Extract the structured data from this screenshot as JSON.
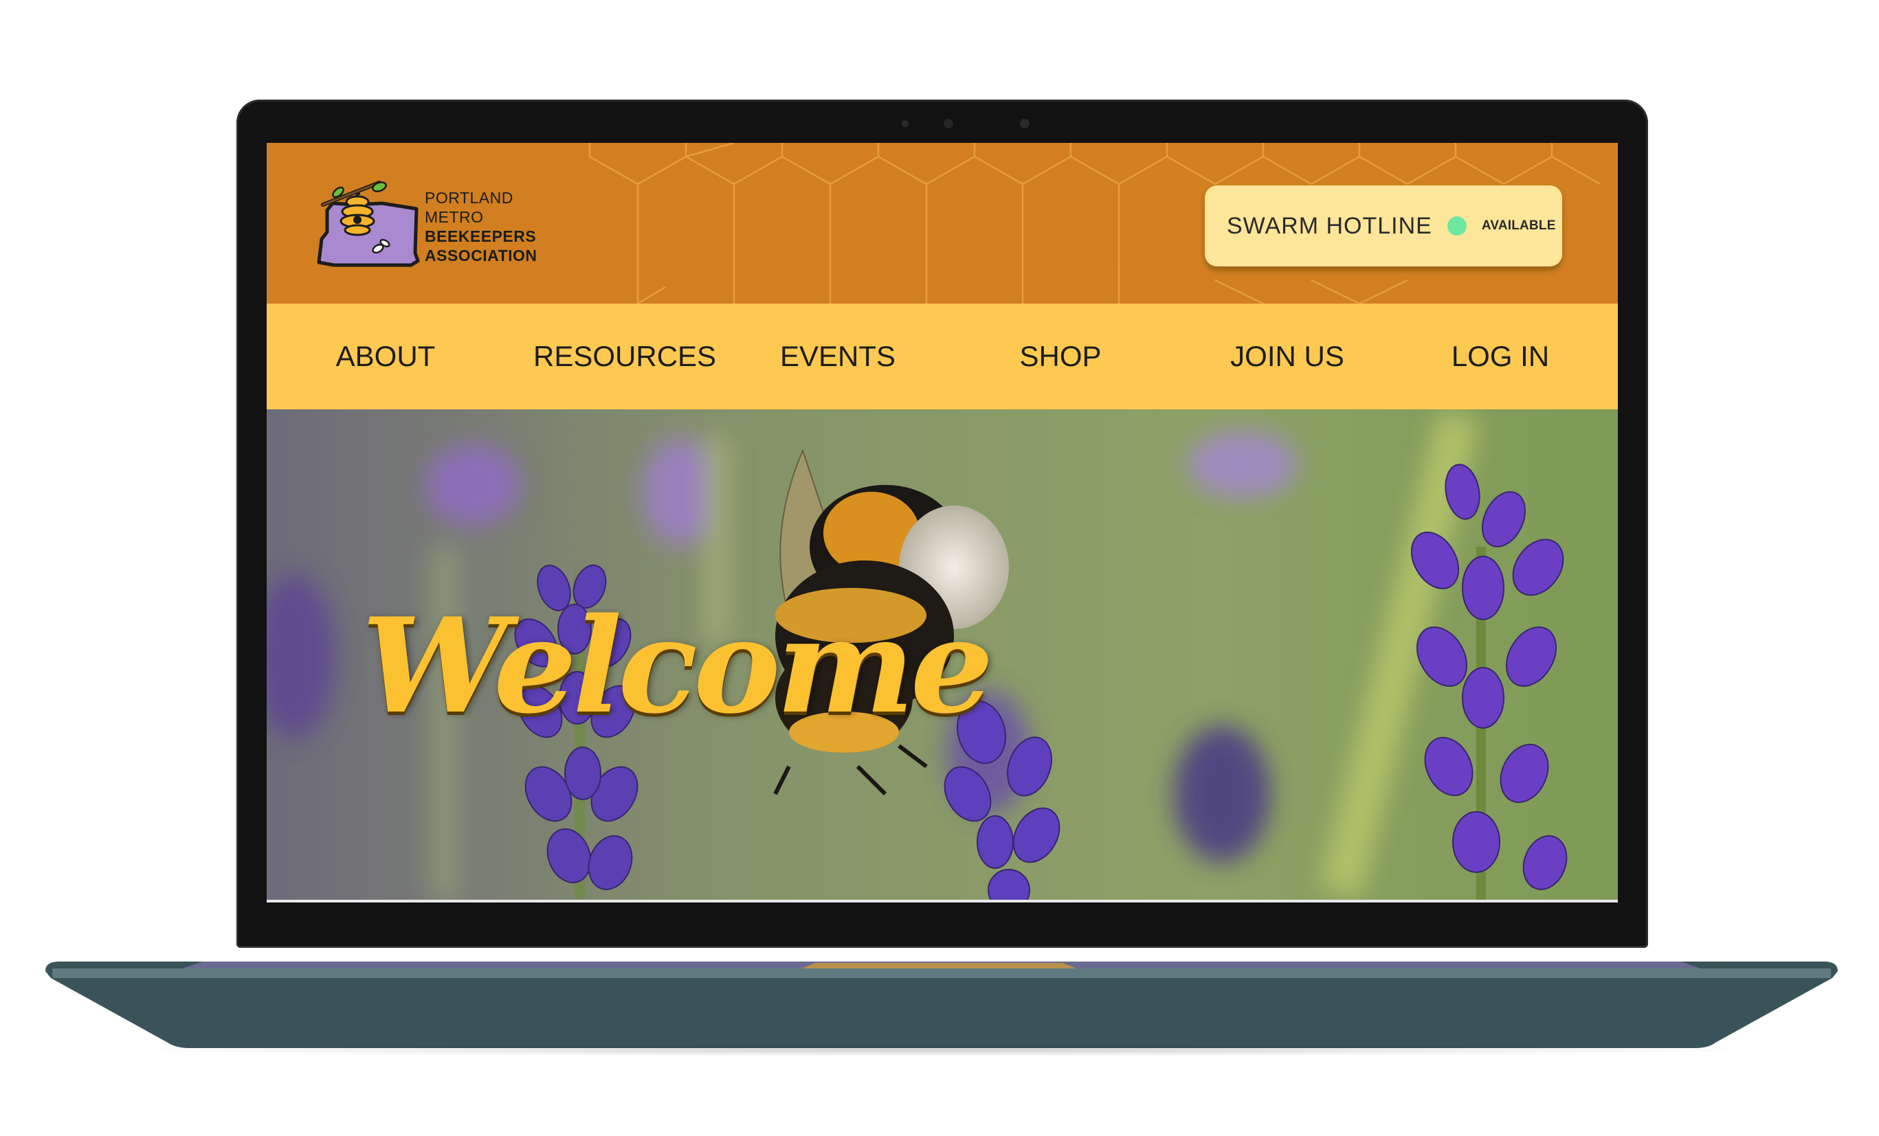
{
  "logo": {
    "line1": "PORTLAND",
    "line2": "METRO",
    "line3": "BEEKEEPERS",
    "line4": "ASSOCIATION"
  },
  "hotline": {
    "label": "SWARM HOTLINE",
    "status": "AVAILABLE",
    "status_color": "#6ee7a0"
  },
  "nav": {
    "items": [
      "ABOUT",
      "RESOURCES",
      "EVENTS",
      "SHOP",
      "JOIN US",
      "LOG IN"
    ]
  },
  "hero": {
    "title": "Welcome"
  },
  "colors": {
    "header_bg": "#d17f20",
    "nav_bg": "#fec951",
    "welcome_text": "#fcc131",
    "logo_purple": "#a989cf"
  }
}
